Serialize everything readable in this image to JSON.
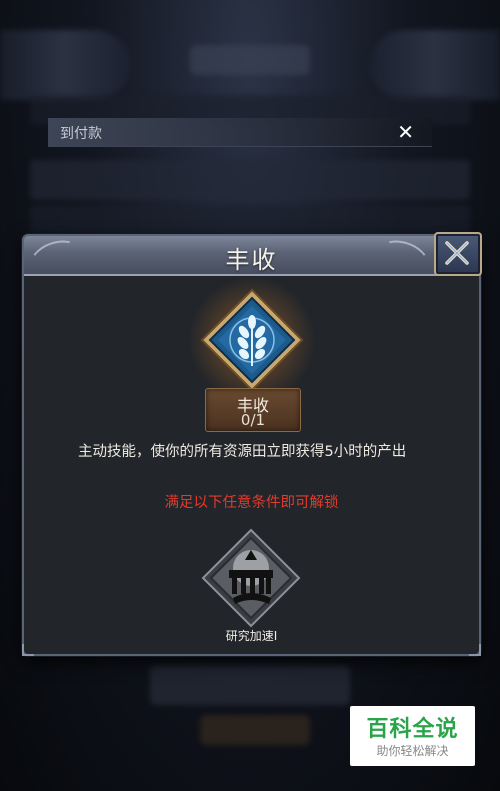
{
  "notice": {
    "text": "到付款",
    "close_glyph": "✕"
  },
  "dialog": {
    "title": "丰收",
    "close_icon": "close-x-icon",
    "skill": {
      "icon": "wheat-emblem-icon",
      "name": "丰收",
      "level": "0/1",
      "description": "主动技能，使你的所有资源田立即获得5小时的产出"
    },
    "unlock_hint": "满足以下任意条件即可解锁",
    "condition": {
      "icon": "research-building-icon",
      "label": "研究加速Ⅰ"
    }
  },
  "watermark": {
    "title": "百科全说",
    "subtitle": "助你轻松解决"
  },
  "colors": {
    "dialog_bg": "#22252a",
    "header": "#5a6275",
    "unlock_hint": "#e53a2b",
    "emblem_blue": "#1d5a8c",
    "watermark_green": "#2aa34a"
  }
}
